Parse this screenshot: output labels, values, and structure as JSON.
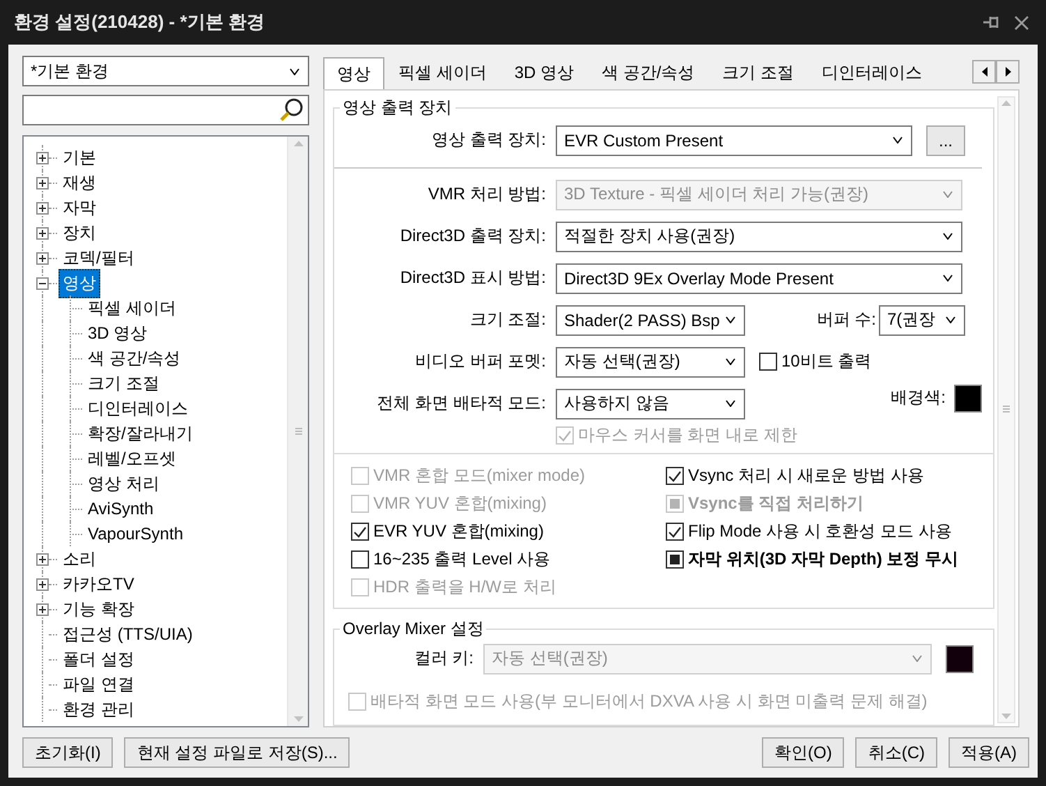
{
  "window": {
    "title": "환경 설정(210428) - *기본 환경"
  },
  "preset": {
    "value": "*기본 환경"
  },
  "tree": [
    {
      "label": "기본",
      "expandable": true,
      "expanded": false,
      "selected": false
    },
    {
      "label": "재생",
      "expandable": true,
      "expanded": false,
      "selected": false
    },
    {
      "label": "자막",
      "expandable": true,
      "expanded": false,
      "selected": false
    },
    {
      "label": "장치",
      "expandable": true,
      "expanded": false,
      "selected": false
    },
    {
      "label": "코덱/필터",
      "expandable": true,
      "expanded": false,
      "selected": false
    },
    {
      "label": "영상",
      "expandable": true,
      "expanded": true,
      "selected": true,
      "children": [
        {
          "label": "픽셀 세이더",
          "selected": false
        },
        {
          "label": "3D 영상",
          "selected": false
        },
        {
          "label": "색 공간/속성",
          "selected": false
        },
        {
          "label": "크기 조절",
          "selected": false
        },
        {
          "label": "디인터레이스",
          "selected": false
        },
        {
          "label": "확장/잘라내기",
          "selected": false
        },
        {
          "label": "레벨/오프셋",
          "selected": false
        },
        {
          "label": "영상 처리",
          "selected": false
        },
        {
          "label": "AviSynth",
          "selected": false
        },
        {
          "label": "VapourSynth",
          "selected": false
        }
      ]
    },
    {
      "label": "소리",
      "expandable": true,
      "expanded": false,
      "selected": false
    },
    {
      "label": "카카오TV",
      "expandable": true,
      "expanded": false,
      "selected": false
    },
    {
      "label": "기능 확장",
      "expandable": true,
      "expanded": false,
      "selected": false
    },
    {
      "label": "접근성 (TTS/UIA)",
      "expandable": false,
      "selected": false
    },
    {
      "label": "폴더 설정",
      "expandable": false,
      "selected": false
    },
    {
      "label": "파일 연결",
      "expandable": false,
      "selected": false
    },
    {
      "label": "환경 관리",
      "expandable": false,
      "selected": false
    }
  ],
  "tabs": [
    {
      "label": "영상",
      "selected": true
    },
    {
      "label": "픽셀 세이더",
      "selected": false
    },
    {
      "label": "3D 영상",
      "selected": false
    },
    {
      "label": "색 공간/속성",
      "selected": false
    },
    {
      "label": "크기 조절",
      "selected": false
    },
    {
      "label": "디인터레이스",
      "selected": false
    }
  ],
  "panel": {
    "group_title": "영상 출력 장치",
    "output_device": {
      "label": "영상 출력 장치:",
      "value": "EVR Custom Present",
      "disabled": false
    },
    "more_button": "...",
    "selects": [
      {
        "label": "VMR 처리 방법:",
        "value": "3D Texture - 픽셀 세이더 처리 가능(권장)",
        "disabled": true
      },
      {
        "label": "Direct3D 출력 장치:",
        "value": "적절한 장치 사용(권장)",
        "disabled": false
      },
      {
        "label": "Direct3D 표시 방법:",
        "value": "Direct3D 9Ex Overlay Mode Present",
        "disabled": false
      }
    ],
    "scaling": {
      "label": "크기 조절:",
      "value": "Shader(2 PASS) Bsp",
      "disabled": false
    },
    "buffer_count": {
      "label": "버퍼 수:",
      "value": "7(권장",
      "disabled": false
    },
    "buffer_format": {
      "label": "비디오 버퍼 포멧:",
      "value": "자동 선택(권장)",
      "disabled": false
    },
    "ten_bit": {
      "label": "10비트 출력",
      "checked": false,
      "disabled": false
    },
    "exclusive_mode": {
      "label": "전체 화면 배타적 모드:",
      "value": "사용하지 않음",
      "disabled": false
    },
    "background": {
      "label": "배경색:",
      "color": "#000000"
    },
    "confine_cursor": {
      "label": "마우스 커서를 화면 내로 제한",
      "checked": true,
      "disabled": true
    },
    "options_left": [
      {
        "label": "VMR 혼합 모드(mixer mode)",
        "checked": false,
        "disabled": true,
        "mixed": false
      },
      {
        "label": "VMR YUV 혼합(mixing)",
        "checked": false,
        "disabled": true,
        "mixed": false
      },
      {
        "label": "EVR YUV 혼합(mixing)",
        "checked": true,
        "disabled": false,
        "mixed": false
      },
      {
        "label": "16~235 출력 Level 사용",
        "checked": false,
        "disabled": false,
        "mixed": false
      },
      {
        "label": "HDR 출력을 H/W로 처리",
        "checked": false,
        "disabled": true,
        "mixed": false
      }
    ],
    "options_right": [
      {
        "label": "Vsync 처리 시 새로운 방법 사용",
        "checked": true,
        "disabled": false,
        "mixed": false
      },
      {
        "label": "Vsync를 직접 처리하기",
        "checked": true,
        "disabled": true,
        "mixed": true
      },
      {
        "label": "Flip Mode 사용 시 호환성 모드 사용",
        "checked": true,
        "disabled": false,
        "mixed": false
      },
      {
        "label": "자막 위치(3D 자막 Depth) 보정 무시",
        "checked": true,
        "disabled": false,
        "mixed": true
      }
    ],
    "overlay_group_title": "Overlay Mixer 설정",
    "color_key": {
      "label": "컬러 키:",
      "value": "자동 선택(권장)",
      "disabled": true
    },
    "color_key_swatch": {
      "color": "#12000c"
    },
    "exclusive_screen": {
      "label": "배타적 화면 모드 사용(부 모니터에서 DXVA 사용 시 화면 미출력 문제 해결)",
      "checked": false,
      "disabled": true
    }
  },
  "buttons_left": [
    "초기화(I)",
    "현재 설정 파일로 저장(S)..."
  ],
  "buttons_right": [
    "확인(O)",
    "취소(C)",
    "적용(A)"
  ]
}
